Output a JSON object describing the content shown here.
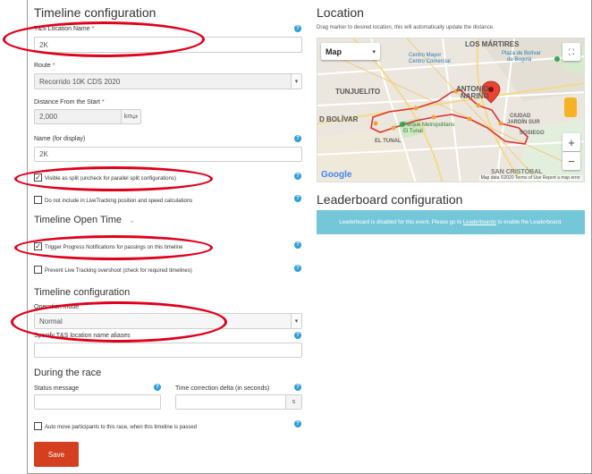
{
  "timeline_config": {
    "title": "Timeline configuration",
    "location_name_label": "T&S Location Name",
    "location_name_value": "2K",
    "route_label": "Route",
    "route_value": "Recorrido 10K CDS 2020",
    "distance_label": "Distance From the Start",
    "distance_value": "2,000",
    "distance_unit": "km",
    "display_name_label": "Name (for display)",
    "display_name_value": "2K",
    "visible_split_label": "Visible as split (uncheck for parallel split configurations)",
    "visible_split_checked": "✓",
    "no_livetracking_label": "Do not include in LiveTracking position and speed calculations"
  },
  "open_time": {
    "title": "Timeline Open Time"
  },
  "notifications": {
    "trigger_label": "Trigger Progress Notifications for passings on this timeline",
    "trigger_checked": "✓",
    "prevent_label": "Prevent Live Tracking overshoot (check for required timelines)"
  },
  "timeline_config2": {
    "title": "Timeline configuration",
    "operation_label": "Operation mode",
    "operation_value": "Normal",
    "aliases_label": "Specify T&S location name aliases"
  },
  "during_race": {
    "title": "During the race",
    "status_label": "Status message",
    "correction_label": "Time correction delta (in seconds)",
    "correction_unit": "s",
    "auto_move_label": "Auto move participants to this race, when this timeline is passed"
  },
  "save_label": "Save",
  "location": {
    "title": "Location",
    "hint": "Drag marker to desired location, this will automatically update the distance.",
    "map_type": "Map",
    "zoom_in": "+",
    "zoom_out": "−",
    "labels": {
      "los_martires": "LOS MÁRTIRES",
      "centro_mayor": "Centro Mayor",
      "centro_mayor2": "Centro Comercial",
      "plaza_bolivar": "Plaza de Bolívar",
      "plaza_bolivar2": "de Bogotá",
      "tunjuelito": "TUNJUELITO",
      "antonio": "ANTONIO",
      "narino": "NARIÑO",
      "bolivar": "D BOLÍVAR",
      "parque": "Parque Metropolitano",
      "tunal": "El Tunal",
      "el_tunal": "EL TUNAL",
      "ciudad": "CIUDAD",
      "jardin": "JARDÍN SUR",
      "sosiego": "SOSIEGO",
      "san_cristobal": "SAN CRISTÓBAL"
    },
    "google": "Google",
    "footer": "Map data ©2020   Terms of Use   Report a map error"
  },
  "leaderboard": {
    "title": "Leaderboard configuration",
    "notice_pre": "Leaderboard is disabled for this event. Please go to",
    "notice_link": "Leaderboards",
    "notice_post": "to enable the Leaderboard."
  },
  "colors": {
    "help": "#2f9fd8",
    "save": "#d43f1f",
    "ring": "#e0001b",
    "leader": "#73c7d8"
  }
}
